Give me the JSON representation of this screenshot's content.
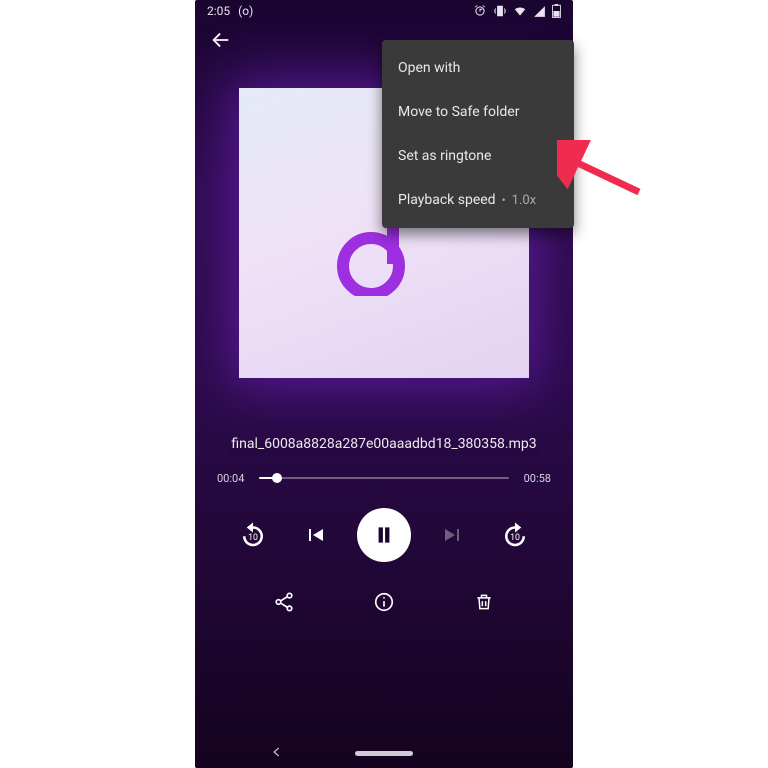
{
  "status": {
    "time": "2:05",
    "rec": "(o)"
  },
  "menu": {
    "open_with": "Open with",
    "move_to_safe": "Move to Safe folder",
    "set_ringtone": "Set as ringtone",
    "playback_speed": "Playback speed",
    "speed_value": "1.0x"
  },
  "player": {
    "filename": "final_6008a8828a287e00aaadbd18_380358.mp3",
    "elapsed": "00:04",
    "total": "00:58",
    "progress_pct": 7
  }
}
